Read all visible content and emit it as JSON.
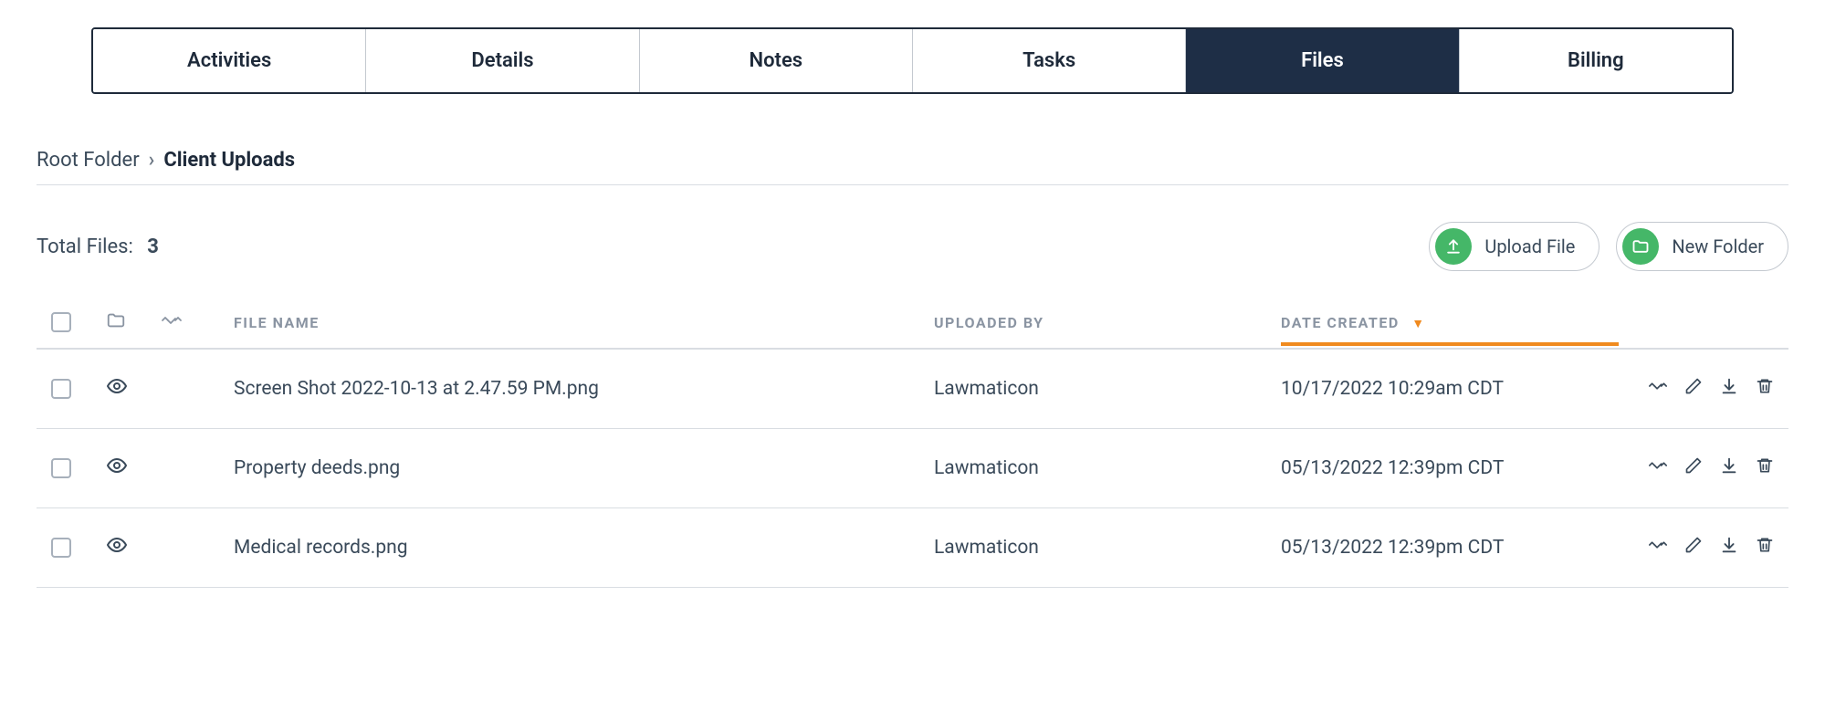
{
  "tabs": [
    {
      "label": "Activities",
      "active": false
    },
    {
      "label": "Details",
      "active": false
    },
    {
      "label": "Notes",
      "active": false
    },
    {
      "label": "Tasks",
      "active": false
    },
    {
      "label": "Files",
      "active": true
    },
    {
      "label": "Billing",
      "active": false
    }
  ],
  "breadcrumb": {
    "root": "Root Folder",
    "current": "Client Uploads"
  },
  "total_files": {
    "label": "Total Files:",
    "count": "3"
  },
  "buttons": {
    "upload": "Upload File",
    "new_folder": "New Folder"
  },
  "columns": {
    "name": "FILE NAME",
    "uploader": "UPLOADED BY",
    "date": "DATE CREATED"
  },
  "files": [
    {
      "name": "Screen Shot 2022-10-13 at 2.47.59 PM.png",
      "uploader": "Lawmaticon",
      "date": "10/17/2022 10:29am CDT"
    },
    {
      "name": "Property deeds.png",
      "uploader": "Lawmaticon",
      "date": "05/13/2022 12:39pm CDT"
    },
    {
      "name": "Medical records.png",
      "uploader": "Lawmaticon",
      "date": "05/13/2022 12:39pm CDT"
    }
  ]
}
